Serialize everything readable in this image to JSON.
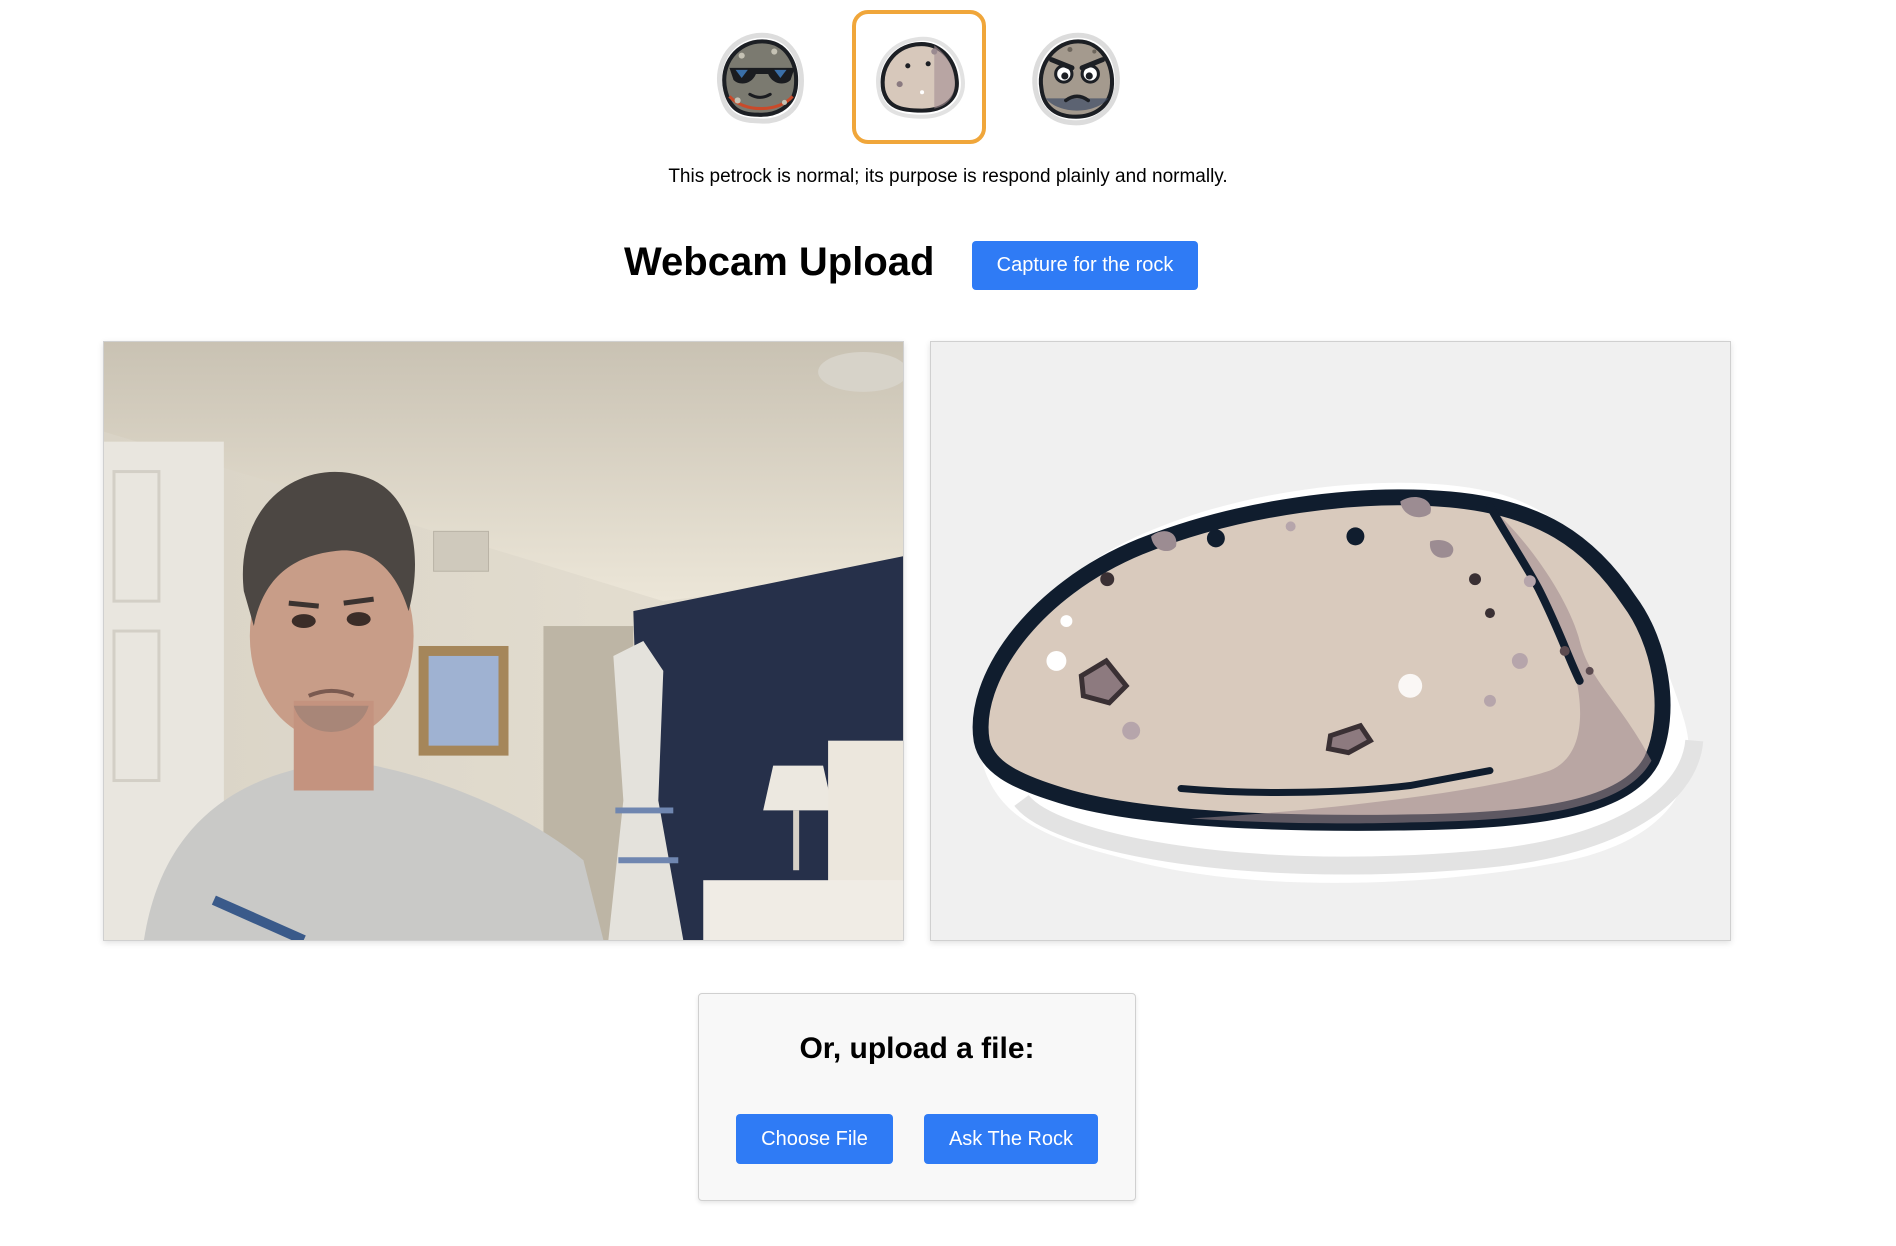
{
  "personas": [
    {
      "name": "cool rock with sunglasses",
      "icon": "cool-rock-icon",
      "selected": false
    },
    {
      "name": "normal rock",
      "icon": "normal-rock-icon",
      "selected": true
    },
    {
      "name": "angry rock",
      "icon": "angry-rock-icon",
      "selected": false
    }
  ],
  "description": "This petrock is normal; its purpose is respond plainly and normally.",
  "webcam": {
    "title": "Webcam Upload",
    "capture_label": "Capture for the rock"
  },
  "upload": {
    "title": "Or, upload a file:",
    "choose_label": "Choose File",
    "ask_label": "Ask The Rock"
  },
  "colors": {
    "accent": "#2f7bf5",
    "selected_border": "#f0a63a",
    "preview_bg": "#f0f0f0"
  }
}
